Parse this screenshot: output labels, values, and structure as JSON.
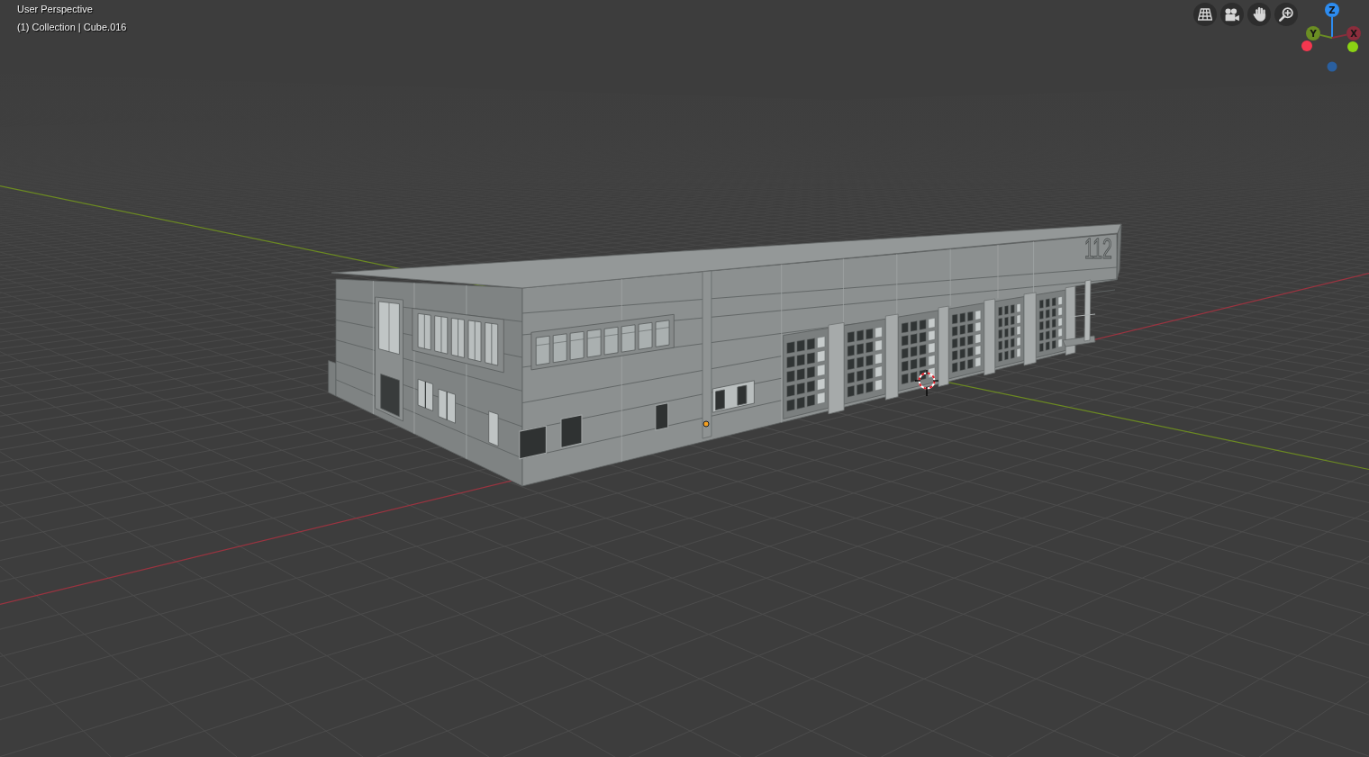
{
  "viewport": {
    "view_name": "User Perspective",
    "object_info": "(1) Collection | Cube.016"
  },
  "building": {
    "sign": "112"
  },
  "gizmo": {
    "axes": [
      {
        "label": "Z",
        "color": "#2d8cf0"
      },
      {
        "label": "Y",
        "color": "#6b8e23"
      },
      {
        "label": "X",
        "color": "#8b2d3c"
      }
    ],
    "negative_axes": [
      {
        "color": "#f5374f"
      },
      {
        "color": "#8bd314"
      },
      {
        "color": "#2a5f9f"
      }
    ]
  }
}
